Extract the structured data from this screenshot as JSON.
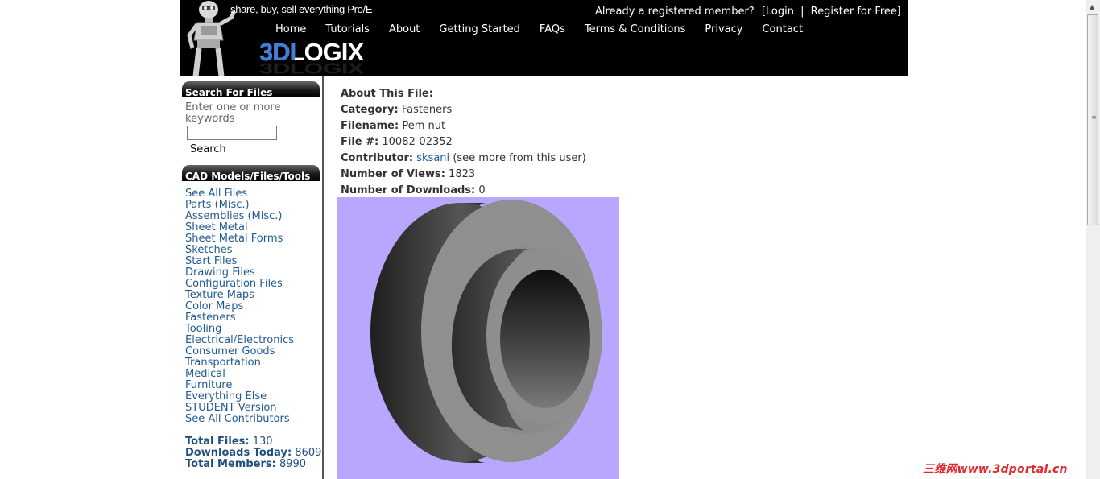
{
  "header": {
    "tagline": "share, buy, sell everything Pro/E",
    "account_prompt": "Already a registered member?",
    "login_label": "[Login",
    "separator": "|",
    "register_label": "Register for Free]",
    "logo_text": "3DLOGIX",
    "logo_accent_color": "#3b7fe0",
    "nav": [
      "Home",
      "Tutorials",
      "About",
      "Getting Started",
      "FAQs",
      "Terms & Conditions",
      "Privacy",
      "Contact"
    ]
  },
  "sidebar": {
    "search_heading": "Search For Files",
    "search_hint": "Enter one or more keywords",
    "search_value": "",
    "search_button": "Search",
    "cad_heading": "CAD Models/Files/Tools",
    "cad_links": [
      "See All Files",
      "Parts (Misc.)",
      "Assemblies (Misc.)",
      "Sheet Metal",
      "Sheet Metal Forms",
      "Sketches",
      "Start Files",
      "Drawing Files",
      "Configuration Files",
      "Texture Maps",
      "Color Maps",
      "Fasteners",
      "Tooling",
      "Electrical/Electronics",
      "Consumer Goods",
      "Transportation",
      "Medical",
      "Furniture",
      "Everything Else",
      "STUDENT Version",
      "See All Contributors"
    ],
    "stats": [
      {
        "label": "Total Files:",
        "value": "130"
      },
      {
        "label": "Downloads Today:",
        "value": "8609"
      },
      {
        "label": "Total Members:",
        "value": "8990"
      }
    ]
  },
  "file_info": {
    "heading": "About This File:",
    "category_label": "Category:",
    "category": "Fasteners",
    "filename_label": "Filename:",
    "filename": "Pem nut",
    "file_num_label": "File #:",
    "file_num": "10082-02352",
    "contributor_label": "Contributor:",
    "contributor": "sksani",
    "contributor_more": "(see more from this user)",
    "views_label": "Number of Views:",
    "views": "1823",
    "downloads_label": "Number of Downloads:",
    "downloads": "0",
    "preview_bg": "#b8a6ff"
  },
  "watermark": "三维网www.3dportal.cn"
}
